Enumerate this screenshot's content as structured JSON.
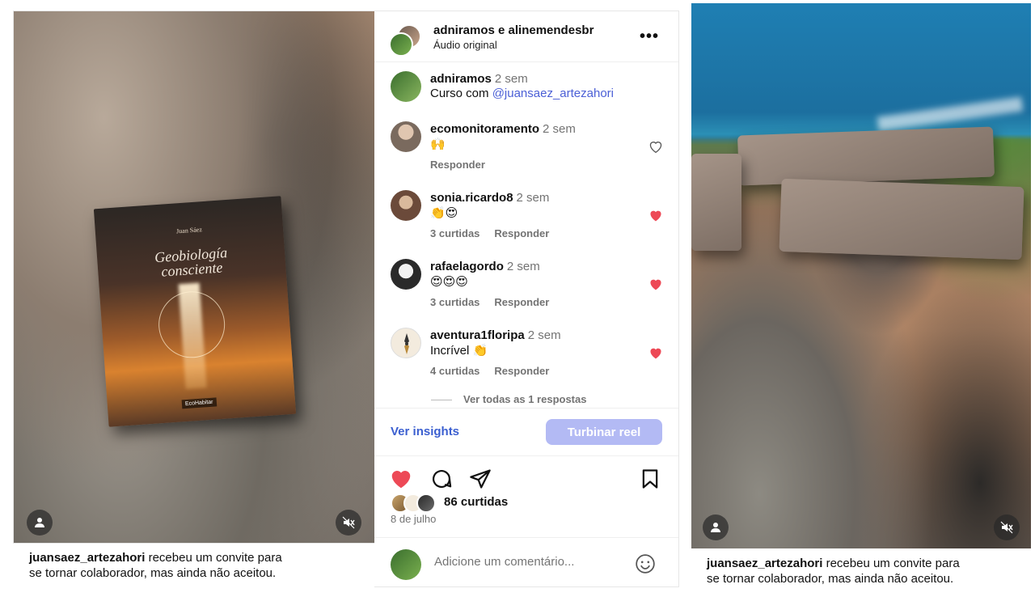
{
  "left_post": {
    "book": {
      "author": "Juan Sáez",
      "title_line1": "Geobiología",
      "title_line2": "consciente",
      "publisher": "EcoHabitar"
    },
    "caption_user": "juansaez_artezahori",
    "caption_text": " recebeu um convite para",
    "caption_line2": "se tornar colaborador, mas ainda não aceitou."
  },
  "header": {
    "names": "adniramos e alinemendesbr",
    "audio": "Áudio original",
    "more_icon": "more-horizontal-icon"
  },
  "comments": [
    {
      "user": "adniramos",
      "time": "2 sem",
      "text_prefix": "Curso com ",
      "mention": "@juansaez_artezahori",
      "likes": "",
      "reply": "",
      "liked": null,
      "avatar_color": "#5a8a3a"
    },
    {
      "user": "ecomonitoramento",
      "time": "2 sem",
      "text_prefix": "🙌",
      "mention": "",
      "likes": "",
      "reply": "Responder",
      "liked": false,
      "avatar_color": "#8a6e5a"
    },
    {
      "user": "sonia.ricardo8",
      "time": "2 sem",
      "text_prefix": "👏😍",
      "mention": "",
      "likes": "3 curtidas",
      "reply": "Responder",
      "liked": true,
      "avatar_color": "#6b4a3a"
    },
    {
      "user": "rafaelagordo",
      "time": "2 sem",
      "text_prefix": "😍😍😍",
      "mention": "",
      "likes": "3 curtidas",
      "reply": "Responder",
      "liked": true,
      "avatar_color": "#2a2a2a"
    },
    {
      "user": "aventura1floripa",
      "time": "2 sem",
      "text_prefix": "Incrível 👏",
      "mention": "",
      "likes": "4 curtidas",
      "reply": "Responder",
      "liked": true,
      "avatar_color": "#f0e6d6"
    }
  ],
  "view_replies": "Ver todas as 1 respostas",
  "insights": {
    "link": "Ver insights",
    "boost": "Turbinar reel"
  },
  "likes": {
    "count": "86 curtidas",
    "date": "8 de julho"
  },
  "comment_box": {
    "placeholder": "Adicione um comentário..."
  },
  "right_post": {
    "caption_user": "juansaez_artezahori",
    "caption_text": " recebeu um convite para",
    "caption_line2": "se tornar colaborador, mas ainda não aceitou."
  },
  "colors": {
    "like_red": "#ed4956",
    "link_blue": "#3b5fd0",
    "boost_bg": "#b3baf4"
  }
}
